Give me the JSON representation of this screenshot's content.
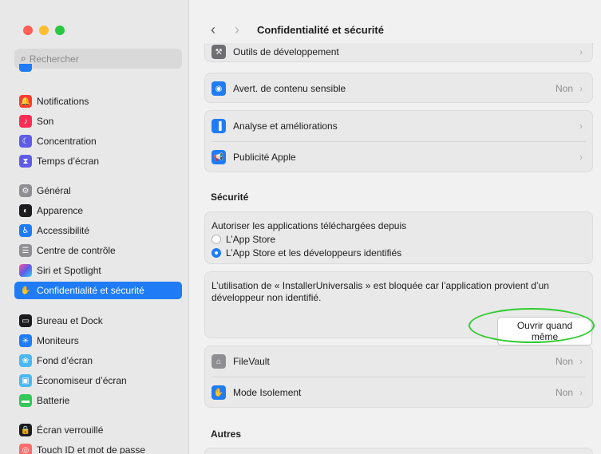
{
  "window": {
    "traffic_colors": [
      "#ff5f57",
      "#febc2e",
      "#28c840"
    ]
  },
  "search": {
    "placeholder": "Rechercher"
  },
  "sidebar": {
    "items": [
      {
        "label": "Notifications",
        "icon": "bell-icon",
        "color": "#ff3b30"
      },
      {
        "label": "Son",
        "icon": "speaker-icon",
        "color": "#ff2d55"
      },
      {
        "label": "Concentration",
        "icon": "moon-icon",
        "color": "#5e5ce6"
      },
      {
        "label": "Temps d’écran",
        "icon": "hourglass-icon",
        "color": "#5e5ce6"
      },
      {
        "label": "Général",
        "icon": "gear-icon",
        "color": "#8e8e93"
      },
      {
        "label": "Apparence",
        "icon": "appearance-icon",
        "color": "#1c1c1e"
      },
      {
        "label": "Accessibilité",
        "icon": "accessibility-icon",
        "color": "#1f7cf6"
      },
      {
        "label": "Centre de contrôle",
        "icon": "toggles-icon",
        "color": "#8e8e93"
      },
      {
        "label": "Siri et Spotlight",
        "icon": "siri-icon",
        "color": "#a34fd1"
      },
      {
        "label": "Confidentialité et sécurité",
        "icon": "hand-icon",
        "color": "#1f7cf6",
        "active": true
      },
      {
        "label": "Bureau et Dock",
        "icon": "dock-icon",
        "color": "#1c1c1e"
      },
      {
        "label": "Moniteurs",
        "icon": "sun-icon",
        "color": "#1f7cf6"
      },
      {
        "label": "Fond d’écran",
        "icon": "flower-icon",
        "color": "#4cb8f5"
      },
      {
        "label": "Économiseur d’écran",
        "icon": "screensaver-icon",
        "color": "#4cb8f5"
      },
      {
        "label": "Batterie",
        "icon": "battery-icon",
        "color": "#34c759"
      },
      {
        "label": "Écran verrouillé",
        "icon": "lock-icon",
        "color": "#1c1c1e"
      },
      {
        "label": "Touch ID et mot de passe",
        "icon": "fingerprint-icon",
        "color": "#ff6b6b"
      }
    ]
  },
  "header": {
    "title": "Confidentialité et sécurité",
    "back": "‹",
    "forward": "›"
  },
  "privacy": {
    "dev_tools": "Outils de développement",
    "sensitive": {
      "label": "Avert. de contenu sensible",
      "value": "Non"
    },
    "analytics": "Analyse et améliorations",
    "ads": "Publicité Apple"
  },
  "security": {
    "title": "Sécurité",
    "allow_label": "Autoriser les applications téléchargées depuis",
    "options": [
      "L’App Store",
      "L’App Store et les développeurs identifiés"
    ],
    "selected_index": 1,
    "blocked_message": "L’utilisation de « InstallerUniversalis » est bloquée car l’application provient d’un développeur non identifié.",
    "open_anyway": "Ouvrir quand même",
    "filevault": {
      "label": "FileVault",
      "value": "Non"
    },
    "lockdown": {
      "label": "Mode Isolement",
      "value": "Non"
    }
  },
  "others": {
    "title": "Autres"
  },
  "colors": {
    "accent": "#1f7cf6",
    "highlight_ring": "#2ecc2e"
  }
}
